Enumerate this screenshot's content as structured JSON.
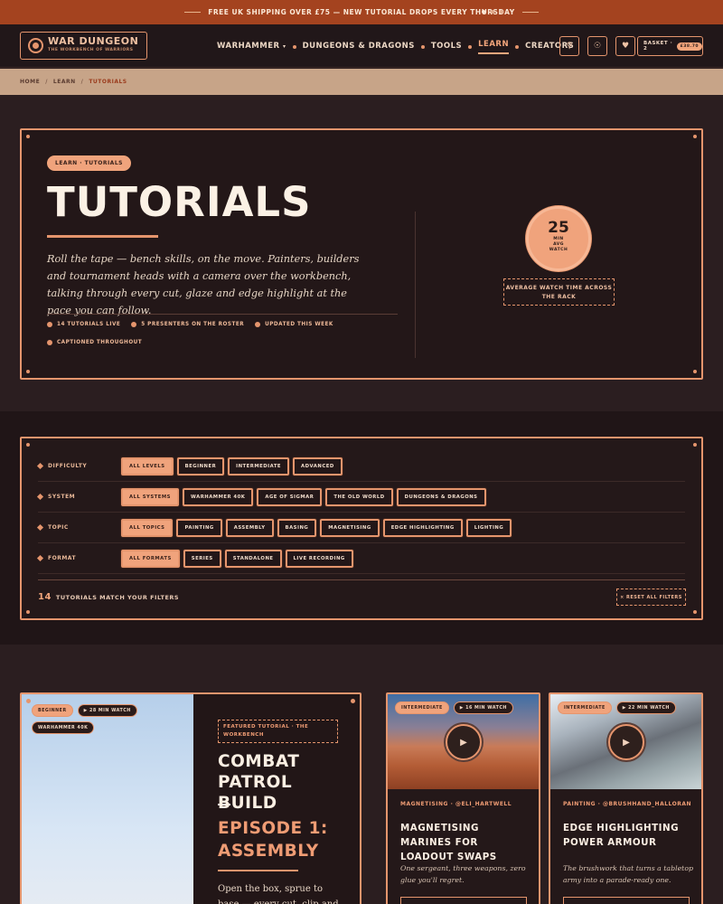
{
  "colors": {
    "accent": "#e5956d",
    "accent_fill": "#f0a37c",
    "promo_bg": "#a4431f",
    "breadcrumb_bg": "#c7a488",
    "page_bg": "#271a1b"
  },
  "promo": {
    "text": "FREE UK SHIPPING OVER £75 — NEW TUTORIAL DROPS EVERY THURSDAY"
  },
  "header": {
    "logo_title": "WAR DUNGEON",
    "logo_tagline": "THE WORKBENCH OF WARRIORS",
    "logo_icon": "cog-icon",
    "nav": [
      {
        "label": "WARHAMMER",
        "caret": "▾"
      },
      {
        "label": "DUNGEONS & DRAGONS"
      },
      {
        "label": "TOOLS"
      },
      {
        "label": "LEARN",
        "active": true
      },
      {
        "label": "CREATORS"
      }
    ],
    "icons": [
      {
        "name": "search-icon",
        "glyph": "⚲"
      },
      {
        "name": "account-icon",
        "glyph": "☉"
      },
      {
        "name": "wishlist-icon",
        "glyph": "♥"
      }
    ],
    "basket_label": "BASKET · 2",
    "basket_price": "£38.70"
  },
  "breadcrumb": [
    "HOME",
    "LEARN",
    "TUTORIALS"
  ],
  "hero": {
    "kicker": "LEARN · TUTORIALS",
    "title": "TUTORIALS",
    "lede": "Roll the tape — bench skills, on the move. Painters, builders and tournament heads with a camera over the workbench, talking through every cut, glaze and edge highlight at the pace you can follow.",
    "stats": [
      "14 TUTORIALS LIVE",
      "5 PRESENTERS ON THE ROSTER",
      "UPDATED THIS WEEK",
      "CAPTIONED THROUGHOUT"
    ],
    "watch_number": "25",
    "watch_unit_1": "MIN",
    "watch_unit_2": "AVG",
    "watch_unit_3": "WATCH",
    "watch_label": "AVERAGE WATCH TIME ACROSS THE RACK"
  },
  "filters": {
    "rows": [
      {
        "label": "DIFFICULTY",
        "options": [
          "ALL LEVELS",
          "BEGINNER",
          "INTERMEDIATE",
          "ADVANCED"
        ],
        "selected": 0
      },
      {
        "label": "SYSTEM",
        "options": [
          "ALL SYSTEMS",
          "WARHAMMER 40K",
          "AGE OF SIGMAR",
          "THE OLD WORLD",
          "DUNGEONS & DRAGONS"
        ],
        "selected": 0
      },
      {
        "label": "TOPIC",
        "options": [
          "ALL TOPICS",
          "PAINTING",
          "ASSEMBLY",
          "BASING",
          "MAGNETISING",
          "EDGE HIGHLIGHTING",
          "LIGHTING"
        ],
        "selected": 0
      },
      {
        "label": "FORMAT",
        "options": [
          "ALL FORMATS",
          "SERIES",
          "STANDALONE",
          "LIVE RECORDING"
        ],
        "selected": 0
      }
    ],
    "count": "14",
    "count_text": "TUTORIALS MATCH YOUR FILTERS",
    "reset": "× RESET ALL FILTERS"
  },
  "featured": {
    "tags": [
      "BEGINNER",
      "▶ 28 MIN WATCH",
      "WARHAMMER 40K"
    ],
    "kicker": "FEATURED TUTORIAL · THE WORKBENCH",
    "title": "COMBAT PATROL BUILD",
    "dash": "—",
    "subtitle": "EPISODE 1: ASSEMBLY",
    "text": "Open the box, sprue to base — every cut, clip and trim"
  },
  "cards": [
    {
      "level": "INTERMEDIATE",
      "duration": "▶ 16 MIN WATCH",
      "meta": "MAGNETISING · @ELI_HARTWELL",
      "title": "MAGNETISING MARINES FOR LOADOUT SWAPS",
      "text": "One sergeant, three weapons, zero glue you'll regret."
    },
    {
      "level": "INTERMEDIATE",
      "duration": "▶ 22 MIN WATCH",
      "meta": "PAINTING · @BRUSHHAND_HALLORAN",
      "title": "EDGE HIGHLIGHTING POWER ARMOUR",
      "text": "The brushwork that turns a tabletop army into a parade-ready one."
    }
  ]
}
